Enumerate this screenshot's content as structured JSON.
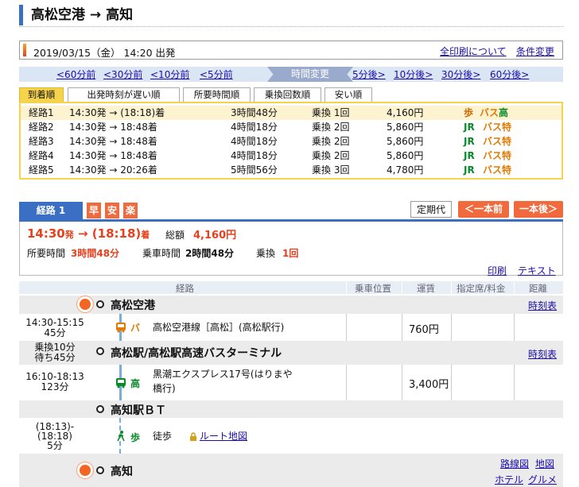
{
  "header": {
    "title": "高松空港 → 高知"
  },
  "condition": {
    "datetime": "2019/03/15（金） 14:20 出発",
    "print_all": "全印刷について",
    "change_conditions": "条件変更"
  },
  "time_nav": {
    "back60": "<60分前",
    "back30": "<30分前",
    "back10": "<10分前",
    "back5": "<5分前",
    "change": "時間変更",
    "fwd5": "5分後>",
    "fwd10": "10分後>",
    "fwd30": "30分後>",
    "fwd60": "60分後>"
  },
  "sort_tabs": [
    "到着順",
    "出発時刻が遅い順",
    "所要時間順",
    "乗換回数順",
    "安い順"
  ],
  "routes": [
    {
      "name": "経路1",
      "time": "14:30発 → (18:18)着",
      "duration": "3時間48分",
      "transfers": "乗換 1回",
      "fare": "4,160円",
      "modes": [
        {
          "t": "歩",
          "c": "ow"
        },
        {
          "t": "バス",
          "c": "o"
        },
        {
          "t": "高",
          "c": "g"
        }
      ]
    },
    {
      "name": "経路2",
      "time": "14:30発 → 18:48着",
      "duration": "4時間18分",
      "transfers": "乗換 2回",
      "fare": "5,860円",
      "modes": [
        {
          "t": "JR",
          "c": "g"
        },
        {
          "t": "バス",
          "c": "o"
        },
        {
          "t": "特",
          "c": "o"
        }
      ]
    },
    {
      "name": "経路3",
      "time": "14:30発 → 18:48着",
      "duration": "4時間18分",
      "transfers": "乗換 2回",
      "fare": "5,860円",
      "modes": [
        {
          "t": "JR",
          "c": "g"
        },
        {
          "t": "バス",
          "c": "o"
        },
        {
          "t": "特",
          "c": "o"
        }
      ]
    },
    {
      "name": "経路4",
      "time": "14:30発 → 18:48着",
      "duration": "4時間18分",
      "transfers": "乗換 2回",
      "fare": "5,860円",
      "modes": [
        {
          "t": "JR",
          "c": "g"
        },
        {
          "t": "バス",
          "c": "o"
        },
        {
          "t": "特",
          "c": "o"
        }
      ]
    },
    {
      "name": "経路5",
      "time": "14:30発 → 20:26着",
      "duration": "5時間56分",
      "transfers": "乗換 3回",
      "fare": "4,780円",
      "modes": [
        {
          "t": "JR",
          "c": "g"
        },
        {
          "t": "バス",
          "c": "o"
        },
        {
          "t": "特",
          "c": "o"
        }
      ]
    }
  ],
  "detail": {
    "tab": "経路 1",
    "badges": [
      "早",
      "安",
      "楽"
    ],
    "commuter": "定期代",
    "prev": "＜一本前",
    "next": "一本後＞",
    "dep": "14:30",
    "dep_suf": "発",
    "arr": "(18:18)",
    "arr_suf": "着",
    "arrow": "→",
    "total_label": "総額",
    "total": "4,160円",
    "req_label": "所要時間",
    "req": "3時間48分",
    "ride_label": "乗車時間",
    "ride": "2時間48分",
    "xfer_label": "乗換",
    "xfer": "1回",
    "print": "印刷",
    "text": "テキスト"
  },
  "table_head": {
    "route": "経路",
    "pos": "乗車位置",
    "fare": "運賃",
    "reserved": "指定席/料金",
    "dist": "距離"
  },
  "stations": [
    {
      "name": "高松空港",
      "link": "時刻表"
    },
    {
      "name": "高松駅/高松駅高速バスターミナル",
      "link": "時刻表",
      "wait1": "乗換10分",
      "wait2": "待ち45分"
    },
    {
      "name": "高知駅ＢＴ"
    },
    {
      "name": "高知",
      "links": [
        "路線図",
        "地図",
        "ホテル",
        "グルメ"
      ]
    }
  ],
  "segments": [
    {
      "time": "14:30-15:15",
      "dur": "45分",
      "mode": "バ",
      "line": "高松空港線［高松］(高松駅行)",
      "fare": "760円"
    },
    {
      "time": "16:10-18:13",
      "dur": "123分",
      "mode": "高",
      "line1": "黒潮エクスプレス17号(はりまや",
      "line2": "橋行)",
      "fare": "3,400円"
    },
    {
      "time1": "(18:13)-",
      "time2": "(18:18)",
      "dur": "5分",
      "mode": "歩",
      "walk": "徒歩",
      "map": "ルート地図"
    }
  ]
}
